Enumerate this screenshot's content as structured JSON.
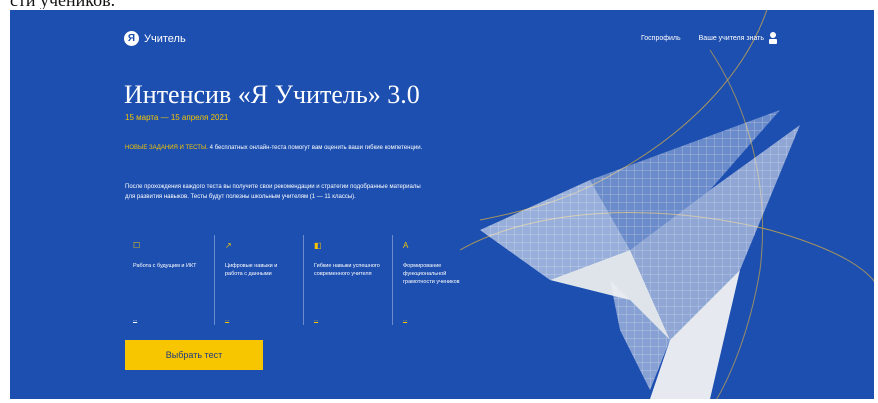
{
  "caption": "сти учеников.",
  "header": {
    "logo_text": "Учитель",
    "nav": [
      "Госпрофиль",
      "Ваше учителя знать"
    ]
  },
  "hero": {
    "title": "Интенсив «Я Учитель» 3.0",
    "dates": "15 марта — 15 апреля 2021",
    "highlight": "НОВЫЕ ЗАДАНИЯ И ТЕСТЫ.",
    "para1_rest": "4 бесплатных онлайн-теста помогут вам оценить ваши гибкие компетенции.",
    "para2": "После прохождения каждого теста вы получите свои рекомендации и стратегии подобранные материалы для развития навыков. Тесты будут полезны школьным учителям (1 — 11 классы)."
  },
  "cards": [
    {
      "icon": "☐",
      "text": "Работа с будущим и ИКТ",
      "link": "..."
    },
    {
      "icon": "↗",
      "text": "Цифровые навыки и работа с данными",
      "link": "..."
    },
    {
      "icon": "◧",
      "text": "Гибкие навыки успешного современного учителя",
      "link": "..."
    },
    {
      "icon": "A",
      "text": "Формирование функциональной грамотности учеников",
      "link": "..."
    }
  ],
  "cta_label": "Выбрать тест",
  "colors": {
    "background": "#1d4fb0",
    "accent": "#f4c400"
  }
}
